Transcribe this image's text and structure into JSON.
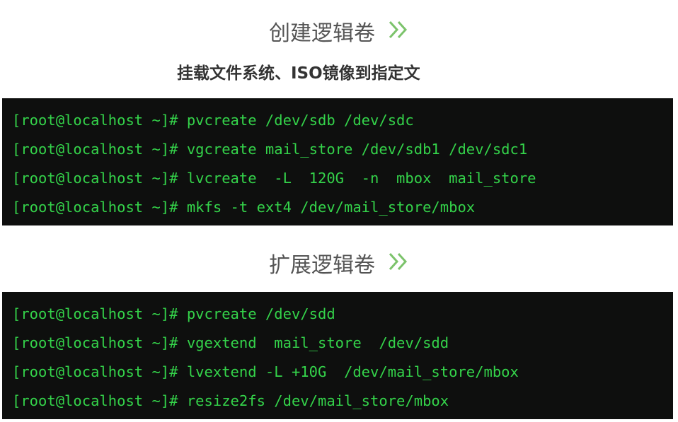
{
  "section1": {
    "title": "创建逻辑卷",
    "icon": "double-chevron-right-icon",
    "subtitle": "挂载文件系统、ISO镜像到指定文"
  },
  "terminal1": {
    "lines": [
      {
        "prompt": "[root@localhost ~]#",
        "command": " pvcreate /dev/sdb /dev/sdc"
      },
      {
        "prompt": "[root@localhost ~]#",
        "command": " vgcreate mail_store /dev/sdb1 /dev/sdc1"
      },
      {
        "prompt": "[root@localhost ~]#",
        "command": " lvcreate  -L  120G  -n  mbox  mail_store"
      },
      {
        "prompt": "[root@localhost ~]#",
        "command": " mkfs -t ext4 /dev/mail_store/mbox"
      }
    ]
  },
  "section2": {
    "title": "扩展逻辑卷",
    "icon": "double-chevron-right-icon"
  },
  "terminal2": {
    "lines": [
      {
        "prompt": "[root@localhost ~]#",
        "command": " pvcreate /dev/sdd"
      },
      {
        "prompt": "[root@localhost ~]#",
        "command": " vgextend  mail_store  /dev/sdd"
      },
      {
        "prompt": "[root@localhost ~]#",
        "command": " lvextend -L +10G  /dev/mail_store/mbox"
      },
      {
        "prompt": "[root@localhost ~]#",
        "command": " resize2fs /dev/mail_store/mbox"
      }
    ]
  },
  "colors": {
    "terminal_bg": "#0e0f0e",
    "terminal_text": "#34d34a",
    "chevron": "#7cc36b",
    "title_text": "#555555"
  }
}
